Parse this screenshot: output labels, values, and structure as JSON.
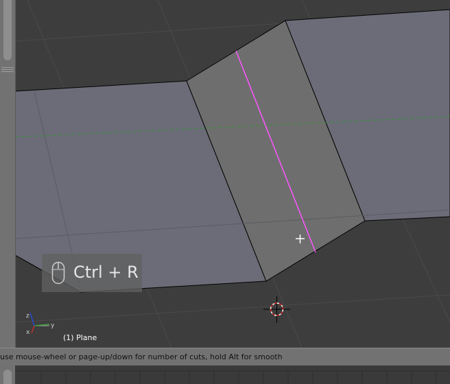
{
  "viewport": {
    "object_label": "(1) Plane",
    "axis_labels": {
      "x": "x",
      "y": "y",
      "z": "z"
    },
    "key_overlay": {
      "text": "Ctrl + R",
      "icon": "mouse-icon"
    }
  },
  "status_bar": {
    "text": "use mouse-wheel or page-up/down for number of cuts, hold Alt for smooth"
  },
  "colors": {
    "viewport_bg": "#3d3d3d",
    "mesh_face": "#6c6d78",
    "selected_face": "#6f6f6f",
    "edge": "#000000",
    "loop_cut": "#ff55ff",
    "y_axis_line": "#3f8a3f",
    "panel": "#727272"
  }
}
